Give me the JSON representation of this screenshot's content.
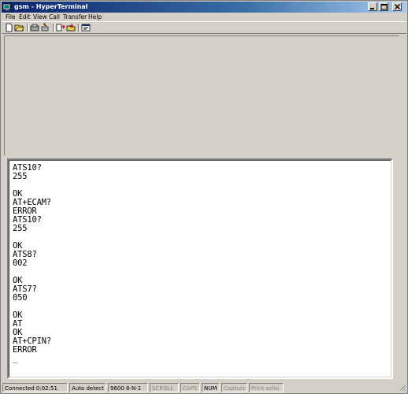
{
  "window": {
    "title": "gsm - HyperTerminal",
    "accent": "#0a246a"
  },
  "menu": {
    "items": [
      "File",
      "Edit",
      "View",
      "Call",
      "Transfer",
      "Help"
    ]
  },
  "toolbar": {
    "buttons": [
      "new-connection-icon",
      "open-icon",
      "call-icon",
      "disconnect-icon",
      "send-icon",
      "receive-icon",
      "properties-icon"
    ]
  },
  "terminal": {
    "lines": [
      "ATS10?",
      "255",
      "",
      "OK",
      "AT+ECAM?",
      "ERROR",
      "ATS10?",
      "255",
      "",
      "OK",
      "ATS8?",
      "002",
      "",
      "OK",
      "ATS7?",
      "050",
      "",
      "OK",
      "AT",
      "OK",
      "AT+CPIN?",
      "ERROR",
      "",
      "_"
    ]
  },
  "status": {
    "connected": "Connected 0:02:51",
    "detect": "Auto detect",
    "settings": "9600 8-N-1",
    "scroll": "SCROLL",
    "caps": "CAPS",
    "num": "NUM",
    "capture": "Capture",
    "print_echo": "Print echo"
  }
}
